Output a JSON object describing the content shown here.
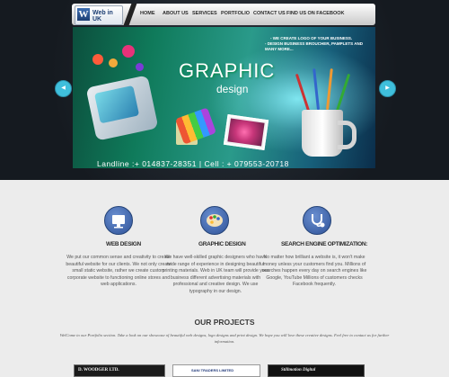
{
  "logo": {
    "letter": "W",
    "text": "Web in UK"
  },
  "nav": [
    "HOME",
    "ABOUT US",
    "SERVICES",
    "PORTFOLIO",
    "CONTACT US",
    "FIND US ON FACEBOOK"
  ],
  "banner": {
    "tagline1": "- WE CREATE LOGO OF YOUR BUSINESS.",
    "tagline2": "- DESIGN BUSINESS BROUCHER, PAMPLETS AND MANY MORE...",
    "title": "GRAPHIC",
    "subtitle": "design",
    "contact": "Landline :+ 014837-28351  |  Cell : + 079553-20718"
  },
  "features": [
    {
      "title": "WEB DESIGN",
      "icon": "monitor-icon",
      "text": "We put our common sense and creativity to create beautiful website for our clients. We not only create small static website, rather we create custom corporate website to functioning online stores and web applications."
    },
    {
      "title": "GRAPHIC DESIGN",
      "icon": "palette-icon",
      "text": "We have well-skilled graphic designers who have wide range of experience in designing beautiful printing materials. Web in UK team will provide your business different advertising materials with professional and creative design. We use typography in our design."
    },
    {
      "title": "SEARCH ENGINE OPTIMIZATION:",
      "icon": "stethoscope-icon",
      "text": "No matter how brilliant a website is, it won't make money unless your customers find you. Millions of searches happen every day on search engines like Google, YouTube Millions of customers checks Facebook frequently."
    }
  ],
  "projects": {
    "title": "OUR PROJECTS",
    "intro": "WelCome to our Portfolio section. Take a look on our showcase of beautiful web designs, logo designs and print design. We hope you will love these creative designs. Feel free to contact us for further information."
  },
  "thumbs": [
    "D. WOODGER LTD.",
    "SANI TRADERS LIMITED",
    "Stillmotion Digital"
  ],
  "colors": {
    "accent": "#3fbfdc",
    "icon_blue": "#2e5298",
    "dark": "#161b22"
  }
}
